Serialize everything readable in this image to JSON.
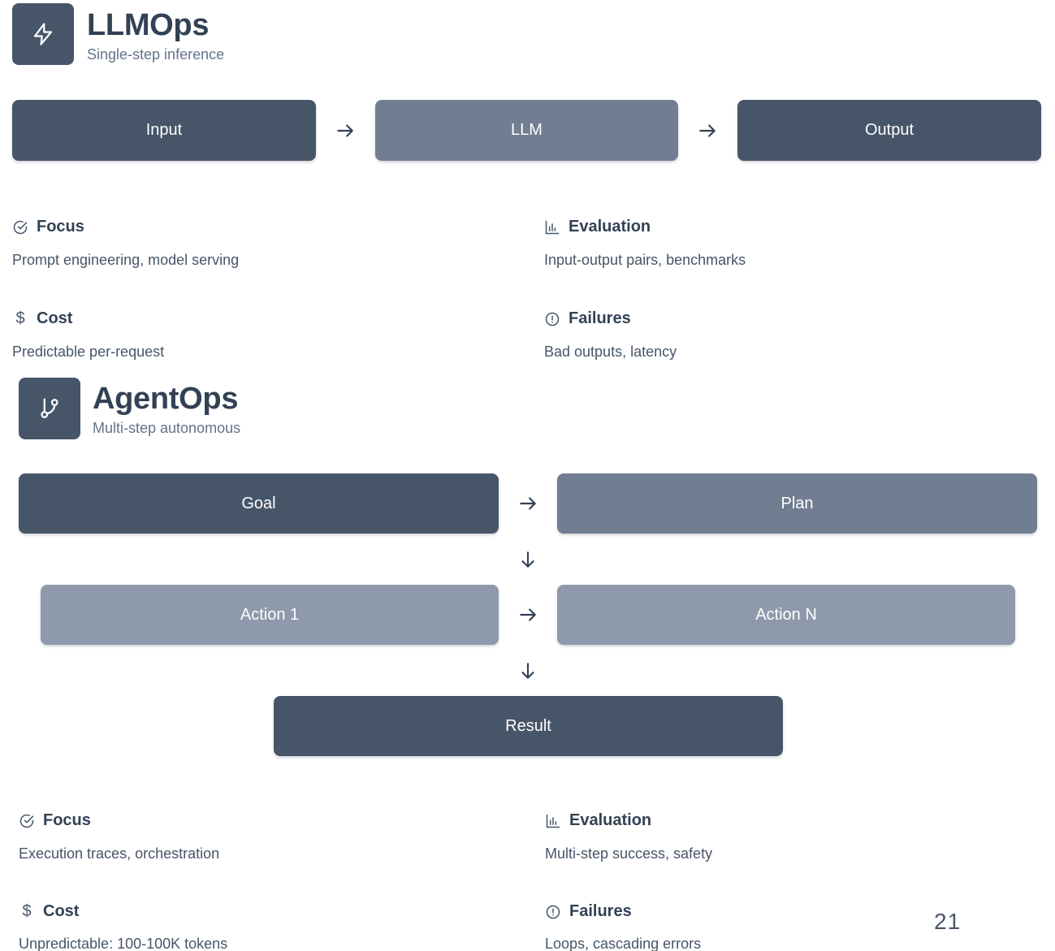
{
  "llmops": {
    "title": "LLMOps",
    "subtitle": "Single-step inference",
    "icon": "lightning-icon",
    "flow": [
      "Input",
      "LLM",
      "Output"
    ],
    "focus_label": "Focus",
    "focus_text": "Prompt engineering, model serving",
    "evaluation_label": "Evaluation",
    "evaluation_text": "Input-output pairs, benchmarks",
    "cost_label": "Cost",
    "cost_text": "Predictable per-request",
    "failures_label": "Failures",
    "failures_text": "Bad outputs, latency"
  },
  "agentops": {
    "title": "AgentOps",
    "subtitle": "Multi-step autonomous",
    "icon": "git-branch-icon",
    "flow": {
      "goal": "Goal",
      "plan": "Plan",
      "action_1": "Action 1",
      "action_n": "Action N",
      "result": "Result"
    },
    "focus_label": "Focus",
    "focus_text": "Execution traces, orchestration",
    "evaluation_label": "Evaluation",
    "evaluation_text": "Multi-step success, safety",
    "cost_label": "Cost",
    "cost_text": "Unpredictable: 100-100K tokens",
    "failures_label": "Failures",
    "failures_text": "Loops, cascading errors"
  },
  "icons": {
    "cost_symbol": "$"
  },
  "colors": {
    "dark_box": "#475569",
    "mid_box": "#717e91",
    "light_box": "#8e9aab",
    "text": "#334155"
  },
  "page_number": "21"
}
